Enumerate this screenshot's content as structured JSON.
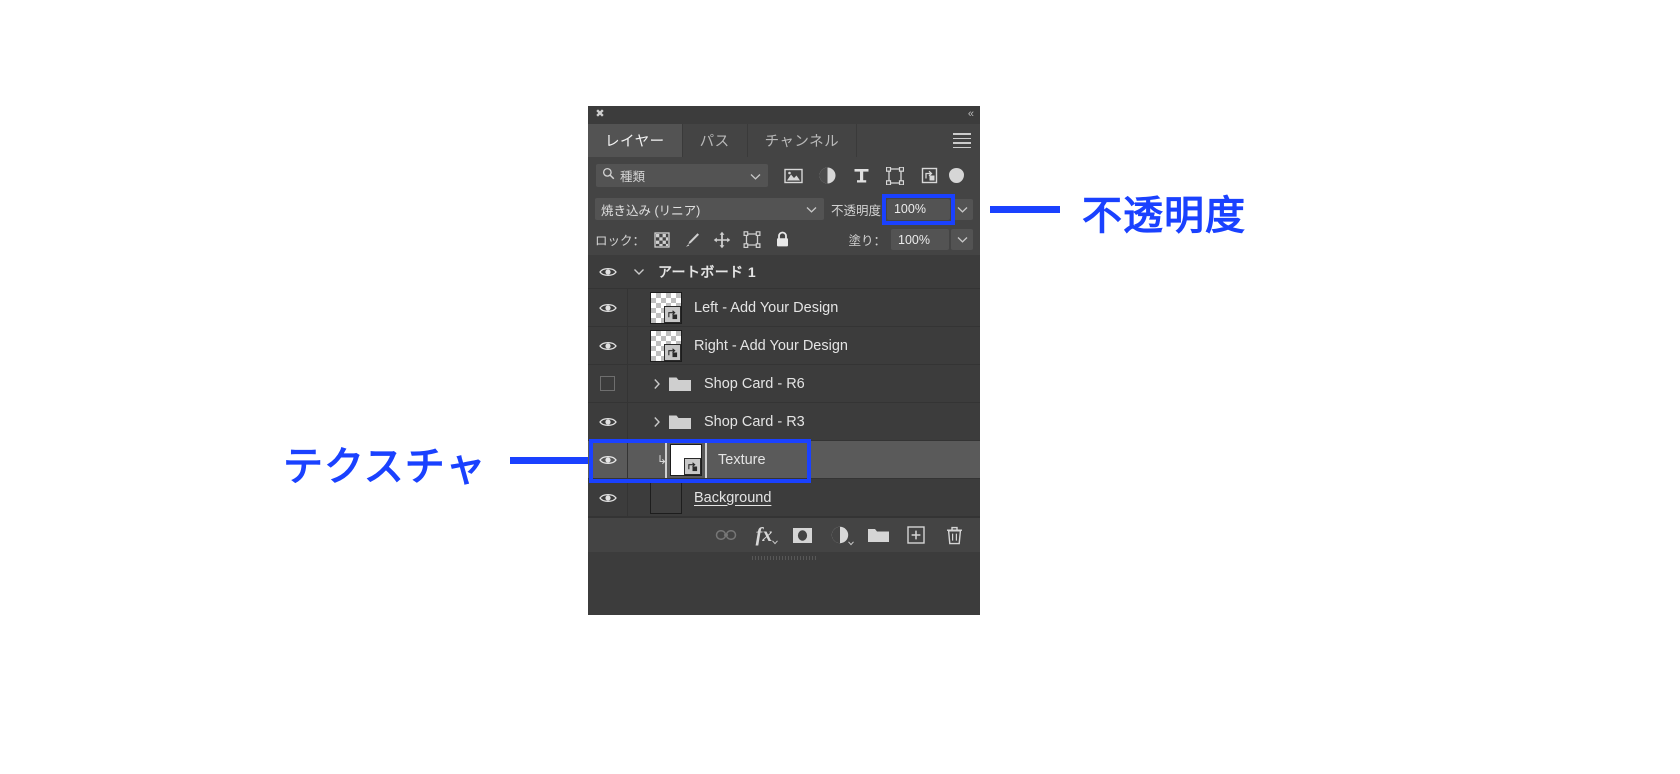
{
  "panel": {
    "close_icon": "close-icon",
    "collapse_icon": "collapse-panel-icon",
    "tabs": [
      {
        "label": "レイヤー",
        "active": true
      },
      {
        "label": "パス",
        "active": false
      },
      {
        "label": "チャンネル",
        "active": false
      }
    ],
    "menu_icon": "panel-menu-icon"
  },
  "filter": {
    "kind_label": "種類",
    "search_icon": "search-icon",
    "caret_icon": "chevron-down-icon",
    "icons": [
      {
        "name": "filter-pixel-icon"
      },
      {
        "name": "filter-adjustment-icon"
      },
      {
        "name": "filter-type-icon"
      },
      {
        "name": "filter-shape-icon"
      },
      {
        "name": "filter-smart-object-icon"
      }
    ],
    "toggle_name": "filter-enable-toggle"
  },
  "blend": {
    "mode_label": "焼き込み (リニア)",
    "mode_caret": "chevron-down-icon",
    "opacity_label": "不透明度",
    "opacity_value": "100%",
    "opacity_caret": "chevron-down-icon"
  },
  "lock": {
    "label": "ロック：",
    "buttons": [
      {
        "name": "lock-transparent-pixels-icon"
      },
      {
        "name": "lock-image-pixels-brush-icon"
      },
      {
        "name": "lock-position-move-icon"
      },
      {
        "name": "lock-artboard-nesting-icon"
      },
      {
        "name": "lock-all-icon"
      }
    ],
    "fill_label": "塗り：",
    "fill_value": "100%",
    "fill_caret": "chevron-down-icon"
  },
  "layers": [
    {
      "name": "アートボード 1",
      "type": "artboard",
      "visible": true,
      "expanded": true,
      "bold": true,
      "selected": false
    },
    {
      "name": "Left - Add Your Design",
      "type": "smart-object",
      "visible": true,
      "thumb": "checker",
      "selected": false
    },
    {
      "name": "Right - Add Your Design",
      "type": "smart-object",
      "visible": true,
      "thumb": "checker",
      "selected": false
    },
    {
      "name": "Shop Card - R6",
      "type": "group",
      "visible": false,
      "expanded": false,
      "selected": false
    },
    {
      "name": "Shop Card - R3",
      "type": "group",
      "visible": true,
      "expanded": false,
      "selected": false
    },
    {
      "name": "Texture",
      "type": "smart-object-clipped",
      "visible": true,
      "thumb": "white",
      "clipped": true,
      "selected": true
    },
    {
      "name": "Background",
      "type": "raster",
      "visible": true,
      "thumb": "solid-dark",
      "editing": true,
      "selected": false
    }
  ],
  "bottom_toolbar": [
    {
      "name": "link-layers-icon",
      "disabled": true
    },
    {
      "name": "layer-style-fx-icon",
      "label": "fx",
      "disabled": false
    },
    {
      "name": "add-layer-mask-icon",
      "disabled": false
    },
    {
      "name": "new-adjustment-layer-icon",
      "disabled": false
    },
    {
      "name": "new-group-icon",
      "disabled": false
    },
    {
      "name": "new-layer-icon",
      "disabled": false
    },
    {
      "name": "delete-layer-icon",
      "disabled": false
    }
  ],
  "annotations": [
    {
      "id": "opacity",
      "text": "不透明度"
    },
    {
      "id": "texture",
      "text": "テクスチャ"
    }
  ],
  "colors": {
    "highlight": "#1a41ff",
    "panel_bg": "#3c3c3c",
    "control_bg": "#444444",
    "selected_row": "#5a5a5a"
  }
}
